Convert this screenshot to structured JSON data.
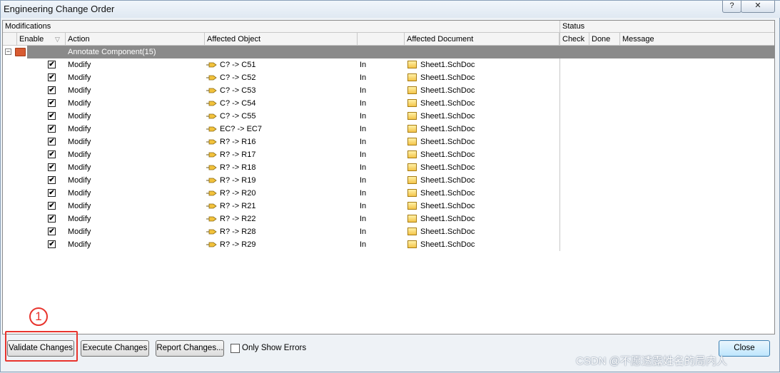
{
  "window": {
    "title": "Engineering Change Order",
    "help_label": "?",
    "close_glyph": "✕"
  },
  "groups": {
    "modifications": "Modifications",
    "status": "Status"
  },
  "columns": {
    "enable": "Enable",
    "action": "Action",
    "affected_object": "Affected Object",
    "affected_document": "Affected Document",
    "check": "Check",
    "done": "Done",
    "message": "Message"
  },
  "sort_glyph": "▽",
  "expander_glyph": "−",
  "group_row": {
    "label": "Annotate Component(15)"
  },
  "rows": [
    {
      "checked": "✔",
      "action": "Modify",
      "object": "C? -> C51",
      "rel": "In",
      "document": "Sheet1.SchDoc"
    },
    {
      "checked": "✔",
      "action": "Modify",
      "object": "C? -> C52",
      "rel": "In",
      "document": "Sheet1.SchDoc"
    },
    {
      "checked": "✔",
      "action": "Modify",
      "object": "C? -> C53",
      "rel": "In",
      "document": "Sheet1.SchDoc"
    },
    {
      "checked": "✔",
      "action": "Modify",
      "object": "C? -> C54",
      "rel": "In",
      "document": "Sheet1.SchDoc"
    },
    {
      "checked": "✔",
      "action": "Modify",
      "object": "C? -> C55",
      "rel": "In",
      "document": "Sheet1.SchDoc"
    },
    {
      "checked": "✔",
      "action": "Modify",
      "object": "EC? -> EC7",
      "rel": "In",
      "document": "Sheet1.SchDoc"
    },
    {
      "checked": "✔",
      "action": "Modify",
      "object": "R? -> R16",
      "rel": "In",
      "document": "Sheet1.SchDoc"
    },
    {
      "checked": "✔",
      "action": "Modify",
      "object": "R? -> R17",
      "rel": "In",
      "document": "Sheet1.SchDoc"
    },
    {
      "checked": "✔",
      "action": "Modify",
      "object": "R? -> R18",
      "rel": "In",
      "document": "Sheet1.SchDoc"
    },
    {
      "checked": "✔",
      "action": "Modify",
      "object": "R? -> R19",
      "rel": "In",
      "document": "Sheet1.SchDoc"
    },
    {
      "checked": "✔",
      "action": "Modify",
      "object": "R? -> R20",
      "rel": "In",
      "document": "Sheet1.SchDoc"
    },
    {
      "checked": "✔",
      "action": "Modify",
      "object": "R? -> R21",
      "rel": "In",
      "document": "Sheet1.SchDoc"
    },
    {
      "checked": "✔",
      "action": "Modify",
      "object": "R? -> R22",
      "rel": "In",
      "document": "Sheet1.SchDoc"
    },
    {
      "checked": "✔",
      "action": "Modify",
      "object": "R? -> R28",
      "rel": "In",
      "document": "Sheet1.SchDoc"
    },
    {
      "checked": "✔",
      "action": "Modify",
      "object": "R? -> R29",
      "rel": "In",
      "document": "Sheet1.SchDoc"
    }
  ],
  "buttons": {
    "validate": "Validate Changes",
    "execute": "Execute Changes",
    "report": "Report Changes...",
    "only_show_errors": "Only Show Errors",
    "close": "Close"
  },
  "annotation": {
    "marker": "1"
  },
  "watermark": "CSDN @不愿透露姓名的局内人",
  "colors": {
    "group_row_bg": "#8a8a8a",
    "highlight": "#e8342d",
    "folder": "#d85b32"
  },
  "icons": {
    "group": "folder-icon",
    "object": "component-arrow-icon",
    "document": "schematic-doc-icon"
  }
}
